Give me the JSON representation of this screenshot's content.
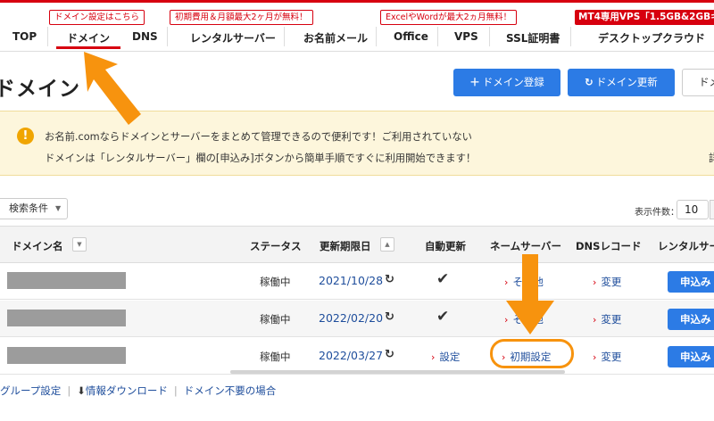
{
  "nav": {
    "items": [
      {
        "label": "TOP"
      },
      {
        "label": "ドメイン"
      },
      {
        "label": "DNS"
      },
      {
        "label": "レンタルサーバー"
      },
      {
        "label": "お名前メール"
      },
      {
        "label": "Office"
      },
      {
        "label": "VPS"
      },
      {
        "label": "SSL証明書"
      },
      {
        "label": "デスクトップクラウド"
      }
    ],
    "badges": [
      "ドメイン設定はこちら",
      "初期費用＆月額最大2ヶ月が無料！",
      "ExcelやWordが最大2ヵ月無料！",
      "MT4専用VPS「1.5GB&2GBキャ"
    ]
  },
  "header": {
    "title": "ドメイン",
    "register_button": "ドメイン登録",
    "renew_button": "ドメイン更新",
    "third_button": "ドメ"
  },
  "notice": {
    "line1": "お名前.comならドメインとサーバーをまとめて管理できるので便利です！ご利用されていない",
    "line2": "ドメインは「レンタルサーバー」欄の[申込み]ボタンから簡単手順ですぐに利用開始できます！",
    "line2_tail": "詳"
  },
  "controls": {
    "filter_label": "検索条件",
    "per_page_label": "表示件数：",
    "per_page_value": "10"
  },
  "table": {
    "headers": {
      "domain": "ドメイン名",
      "status": "ステータス",
      "expiry": "更新期限日",
      "auto_renew": "自動更新",
      "nameserver": "ネームサーバー",
      "dns": "DNSレコード",
      "rental": "レンタルサー"
    },
    "rows": [
      {
        "status": "稼働中",
        "expiry": "2021/10/28",
        "nameserver": "その他",
        "dns": "変更",
        "apply": "申込み"
      },
      {
        "status": "稼働中",
        "expiry": "2022/02/20",
        "nameserver": "その他",
        "dns": "変更",
        "apply": "申込み"
      },
      {
        "status": "稼働中",
        "expiry": "2022/03/27",
        "auto_renew": "設定",
        "nameserver": "初期設定",
        "dns": "変更",
        "apply": "申込み"
      }
    ]
  },
  "footer": {
    "group_settings": "グループ設定",
    "download": "情報ダウンロード",
    "unneeded": "ドメイン不要の場合"
  },
  "colors": {
    "brand_red": "#d7000f",
    "primary_blue": "#2c7be5",
    "annotation_orange": "#f7930e",
    "notice_bg": "#fdf6dc"
  }
}
